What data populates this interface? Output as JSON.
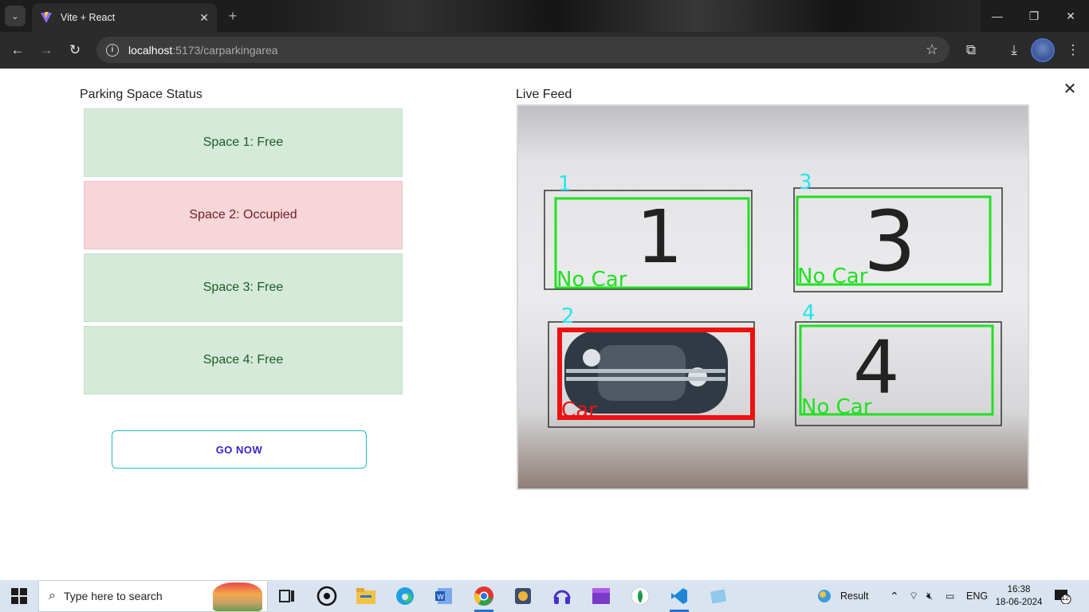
{
  "browser": {
    "tab_title": "Vite + React",
    "tab_close": "✕",
    "new_tab": "+",
    "url_host": "localhost",
    "url_path": ":5173/carparkingarea"
  },
  "page": {
    "status_title": "Parking Space Status",
    "spaces": [
      {
        "label": "Space 1: Free",
        "status": "free"
      },
      {
        "label": "Space 2: Occupied",
        "status": "occupied"
      },
      {
        "label": "Space 3: Free",
        "status": "free"
      },
      {
        "label": "Space 4: Free",
        "status": "free"
      }
    ],
    "go_button": "GO NOW",
    "feed_title": "Live Feed",
    "close": "✕",
    "feed": {
      "slots": [
        {
          "number": "1",
          "digit": "1",
          "label": "No Car",
          "box_color": "#22e022"
        },
        {
          "number": "2",
          "digit": "",
          "label": "Car",
          "box_color": "#ee1111"
        },
        {
          "number": "3",
          "digit": "3",
          "label": "No Car",
          "box_color": "#22e022"
        },
        {
          "number": "4",
          "digit": "4",
          "label": "No Car",
          "box_color": "#22e022"
        }
      ],
      "number_color": "#22e6ee"
    }
  },
  "taskbar": {
    "search_placeholder": "Type here to search",
    "weather": "Result",
    "language": "ENG",
    "time": "16:38",
    "date": "18-06-2024",
    "notification_count": "12"
  }
}
